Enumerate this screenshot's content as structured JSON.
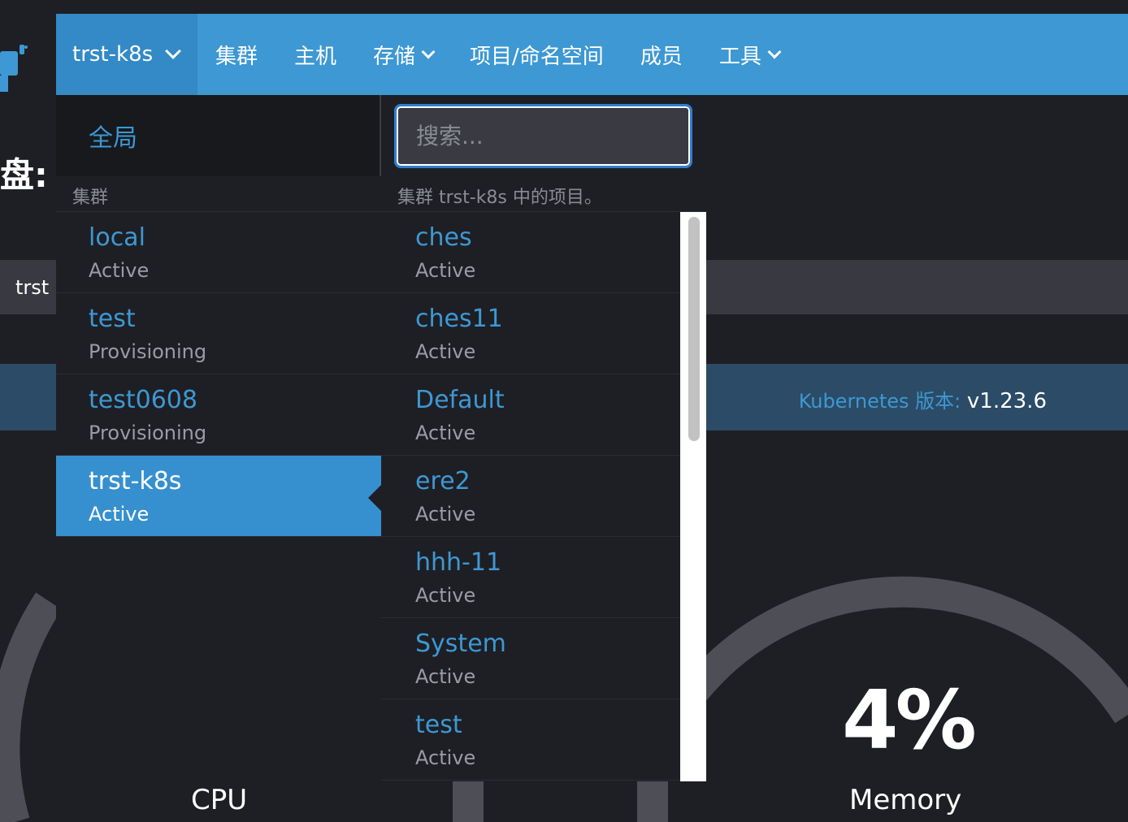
{
  "navbar": {
    "cluster_switch_label": "trst-k8s",
    "items": [
      {
        "label": "集群",
        "has_dropdown": false
      },
      {
        "label": "主机",
        "has_dropdown": false
      },
      {
        "label": "存储",
        "has_dropdown": true
      },
      {
        "label": "项目/命名空间",
        "has_dropdown": false
      },
      {
        "label": "成员",
        "has_dropdown": false
      },
      {
        "label": "工具",
        "has_dropdown": true
      }
    ]
  },
  "background": {
    "title_fragment": "盘:",
    "bar_text": "trst",
    "k8s_version_label": "Kubernetes 版本:",
    "k8s_version_value": "v1.23.6",
    "memory_percent": "4%",
    "cpu_label": "CPU",
    "memory_label": "Memory"
  },
  "dropdown": {
    "global_label": "全局",
    "search_placeholder": "搜索...",
    "clusters_header": "集群",
    "projects_header": "集群 trst-k8s 中的项目。",
    "clusters": [
      {
        "name": "local",
        "state": "Active",
        "selected": false
      },
      {
        "name": "test",
        "state": "Provisioning",
        "selected": false
      },
      {
        "name": "test0608",
        "state": "Provisioning",
        "selected": false
      },
      {
        "name": "trst-k8s",
        "state": "Active",
        "selected": true
      }
    ],
    "projects": [
      {
        "name": "ches",
        "state": "Active"
      },
      {
        "name": "ches11",
        "state": "Active"
      },
      {
        "name": "Default",
        "state": "Active"
      },
      {
        "name": "ere2",
        "state": "Active"
      },
      {
        "name": "hhh-11",
        "state": "Active"
      },
      {
        "name": "System",
        "state": "Active"
      },
      {
        "name": "test",
        "state": "Active"
      }
    ]
  },
  "colors": {
    "accent": "#3d98d3",
    "navbar": "#3d98d3",
    "background": "#1e1f24",
    "selected_item": "#3690cf"
  }
}
